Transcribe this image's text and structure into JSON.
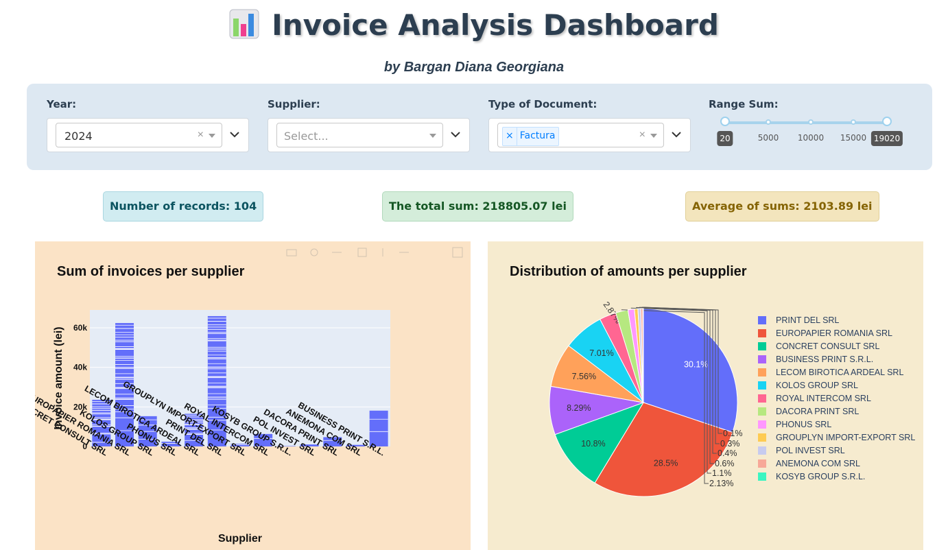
{
  "header": {
    "title": "Invoice Analysis Dashboard",
    "icon": "bar-chart-icon",
    "subtitle": "by Bargan Diana Georgiana"
  },
  "filters": {
    "year": {
      "label": "Year:",
      "value": "2024"
    },
    "supplier": {
      "label": "Supplier:",
      "placeholder": "Select..."
    },
    "doc_type": {
      "label": "Type of Document:",
      "tag": "Factura"
    },
    "range": {
      "label": "Range Sum:",
      "min": 20,
      "max": 19020,
      "low": 20,
      "high": 19020,
      "marks": [
        "5000",
        "10000",
        "15000"
      ],
      "low_label": "20",
      "high_label": "19020"
    }
  },
  "stats": {
    "records": "Number of records: 104",
    "total": "The total sum: 218805.07 lei",
    "average": "Average of sums: 2103.89 lei"
  },
  "colors": {
    "bar": "#636efa",
    "plot_bg": "#e5ecf6",
    "panel1": "#fbe3c6",
    "panel2": "#f6ebcf"
  },
  "chart_data": [
    {
      "type": "bar",
      "title": "Sum of invoices per supplier",
      "xlabel": "Supplier",
      "ylabel": "Invoice amount (lei)",
      "ylim": [
        0,
        69000
      ],
      "yticks": [
        "0",
        "20k",
        "40k",
        "60k"
      ],
      "ytick_values": [
        0,
        20000,
        40000,
        60000
      ],
      "grid": true,
      "categories": [
        "CONCRET CONSULT SRL",
        "EUROPAPIER ROMANIA SRL",
        "KOLOS GROUP SRL",
        "PHONUS SRL",
        "LECOM BIROTICA ARDEAL SRL",
        "PRINT DEL SRL",
        "GROUPLYN IMPORT-EXPORT SRL",
        "ROYAL INTERCOM SRL",
        "KOSYB GROUP S.R.L.",
        "POL INVEST SRL",
        "DACORA PRINT SRL",
        "ANEMONA COM SRL",
        "BUSINESS PRINT S.R.L."
      ],
      "values": [
        23600,
        62400,
        15300,
        2400,
        16500,
        65900,
        1300,
        6300,
        200,
        1000,
        4700,
        800,
        18100
      ],
      "segments": [
        20,
        40,
        6,
        2,
        18,
        45,
        2,
        2,
        1,
        1,
        2,
        1,
        3
      ]
    },
    {
      "type": "pie",
      "title": "Distribution of amounts per supplier",
      "legend_position": "right",
      "labels": [
        "PRINT DEL SRL",
        "EUROPAPIER ROMANIA SRL",
        "CONCRET CONSULT SRL",
        "BUSINESS PRINT S.R.L.",
        "LECOM BIROTICA ARDEAL SRL",
        "KOLOS GROUP SRL",
        "ROYAL INTERCOM SRL",
        "DACORA PRINT SRL",
        "PHONUS SRL",
        "GROUPLYN IMPORT-EXPORT SRL",
        "POL INVEST SRL",
        "ANEMONA COM SRL",
        "KOSYB GROUP S.R.L."
      ],
      "values": [
        30.1,
        28.5,
        10.8,
        8.29,
        7.56,
        7.01,
        2.87,
        2.13,
        1.1,
        0.6,
        0.49,
        0.35,
        0.1
      ],
      "text": [
        "30.1%",
        "28.5%",
        "10.8%",
        "8.29%",
        "7.56%",
        "7.01%",
        "2.87%",
        "2.13%",
        "1.1%",
        "0.6%",
        "0.4%",
        "0.3%",
        "0.1%"
      ],
      "colors": [
        "#636efa",
        "#ef553b",
        "#00cc96",
        "#ab63fa",
        "#ffa15a",
        "#19d3f3",
        "#ff6692",
        "#b6e880",
        "#ff97ff",
        "#fecb52",
        "#c7cbef",
        "#f7a898",
        "#3cf5c1"
      ]
    }
  ]
}
